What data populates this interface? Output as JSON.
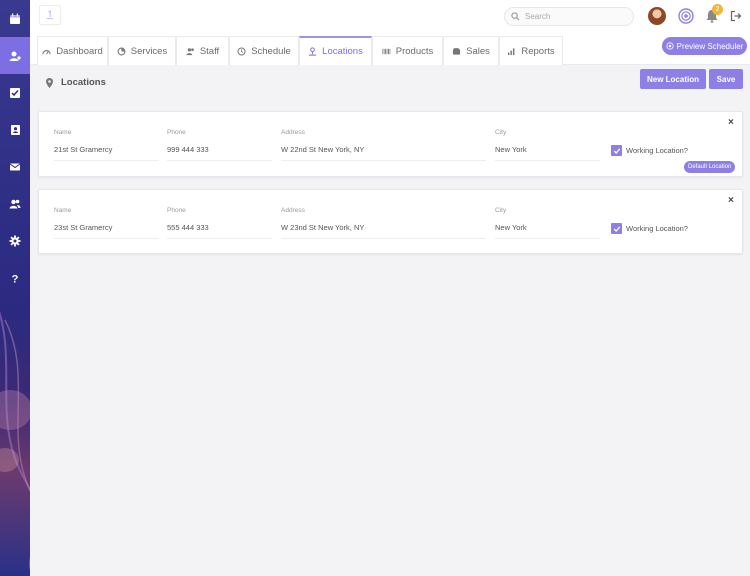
{
  "sidebar": {
    "items": [
      {
        "icon": "calendar-icon",
        "active": false
      },
      {
        "icon": "user-pin-icon",
        "active": true
      },
      {
        "icon": "checkbox-icon",
        "active": false
      },
      {
        "icon": "contact-book-icon",
        "active": false
      },
      {
        "icon": "envelope-icon",
        "active": false
      },
      {
        "icon": "users-icon",
        "active": false
      },
      {
        "icon": "gear-icon",
        "active": false
      },
      {
        "icon": "help-icon",
        "active": false
      }
    ]
  },
  "topbar": {
    "search_placeholder": "Search",
    "notification_count": "2"
  },
  "tabs": [
    {
      "label": "Dashboard",
      "icon": "gauge-icon"
    },
    {
      "label": "Services",
      "icon": "pie-icon"
    },
    {
      "label": "Staff",
      "icon": "users-icon"
    },
    {
      "label": "Schedule",
      "icon": "clock-icon"
    },
    {
      "label": "Locations",
      "icon": "pin-person-icon",
      "active": true
    },
    {
      "label": "Products",
      "icon": "barcode-icon"
    },
    {
      "label": "Sales",
      "icon": "wallet-icon"
    },
    {
      "label": "Reports",
      "icon": "bar-chart-icon"
    }
  ],
  "preview_button": "Preview Scheduler",
  "page": {
    "title": "Locations",
    "new_location_label": "New Location",
    "save_label": "Save"
  },
  "field_labels": {
    "name": "Name",
    "phone": "Phone",
    "address": "Address",
    "city": "City"
  },
  "locations": [
    {
      "name": "21st St  Gramercy",
      "phone": "999 444 333",
      "address": "W 22nd St New York, NY",
      "city": "New York",
      "working_label": "Working Location?",
      "working": true,
      "default_badge": "Default Location"
    },
    {
      "name": "23st St Gramercy",
      "phone": "555 444 333",
      "address": "W 23nd St New York, NY",
      "city": "New York",
      "working_label": "Working Location?",
      "working": true
    }
  ],
  "close_glyph": "×",
  "colors": {
    "accent": "#8e7fe6",
    "sidebar": "#2e2d84",
    "badge": "#f2b632"
  }
}
